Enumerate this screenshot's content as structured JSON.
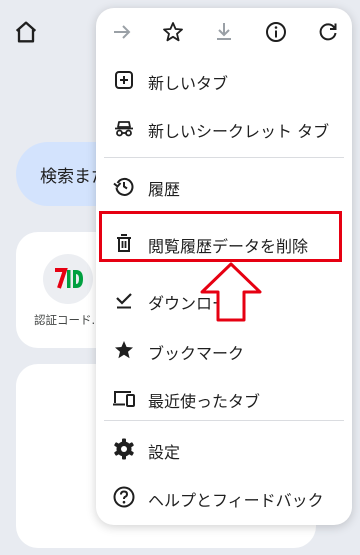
{
  "background": {
    "search_text": "検索また",
    "shortcut_label": "認証コード..."
  },
  "menu": {
    "toolbar": [
      "forward-icon",
      "bookmark-star-icon",
      "download-icon",
      "info-icon",
      "reload-icon"
    ],
    "items": [
      {
        "icon": "new-tab-icon",
        "label": "新しいタブ"
      },
      {
        "icon": "incognito-icon",
        "label": "新しいシークレット タブ"
      },
      {
        "icon": "history-icon",
        "label": "履歴"
      },
      {
        "icon": "trash-icon",
        "label": "閲覧履歴データを削除"
      },
      {
        "icon": "downloads-check-icon",
        "label": "ダウンロード"
      },
      {
        "icon": "bookmarks-star-icon",
        "label": "ブックマーク"
      },
      {
        "icon": "recent-tabs-icon",
        "label": "最近使ったタブ"
      },
      {
        "icon": "settings-gear-icon",
        "label": "設定"
      },
      {
        "icon": "help-icon",
        "label": "ヘルプとフィードバック"
      }
    ]
  },
  "annotation": {
    "highlight_color": "#e60012",
    "arrow_direction": "up"
  }
}
